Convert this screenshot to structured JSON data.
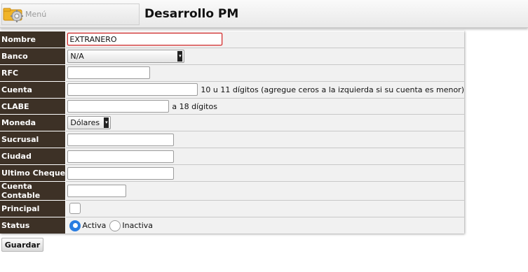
{
  "header": {
    "menu_label": "Menú",
    "menu_icon": "gear-folder-icon",
    "title": "Desarrollo PM"
  },
  "form": {
    "nombre": {
      "label": "Nombre",
      "value": "EXTRANERO"
    },
    "banco": {
      "label": "Banco",
      "value": "N/A"
    },
    "rfc": {
      "label": "RFC",
      "value": ""
    },
    "cuenta": {
      "label": "Cuenta",
      "value": "",
      "hint": "10 u 11 dígitos (agregue ceros a la izquierda si su cuenta es menor)"
    },
    "clabe": {
      "label": "CLABE",
      "value": "",
      "hint": "a 18 dígitos"
    },
    "moneda": {
      "label": "Moneda",
      "value": "Dólares"
    },
    "sucursal": {
      "label": "Sucrusal",
      "value": ""
    },
    "ciudad": {
      "label": "Ciudad",
      "value": ""
    },
    "ultimo_cheque": {
      "label": "Ultimo Cheque",
      "value": ""
    },
    "cuenta_contable": {
      "label": "Cuenta Contable",
      "value": ""
    },
    "principal": {
      "label": "Principal",
      "checked": false
    },
    "status": {
      "label": "Status",
      "options": [
        "Activa",
        "Inactiva"
      ],
      "selected": "Activa"
    }
  },
  "actions": {
    "save_label": "Guardar"
  },
  "colors": {
    "label_bg": "#3d3126",
    "field_bg": "#f1f1f1",
    "active_border": "#cc2b2b",
    "radio_accent": "#2a7de1"
  }
}
